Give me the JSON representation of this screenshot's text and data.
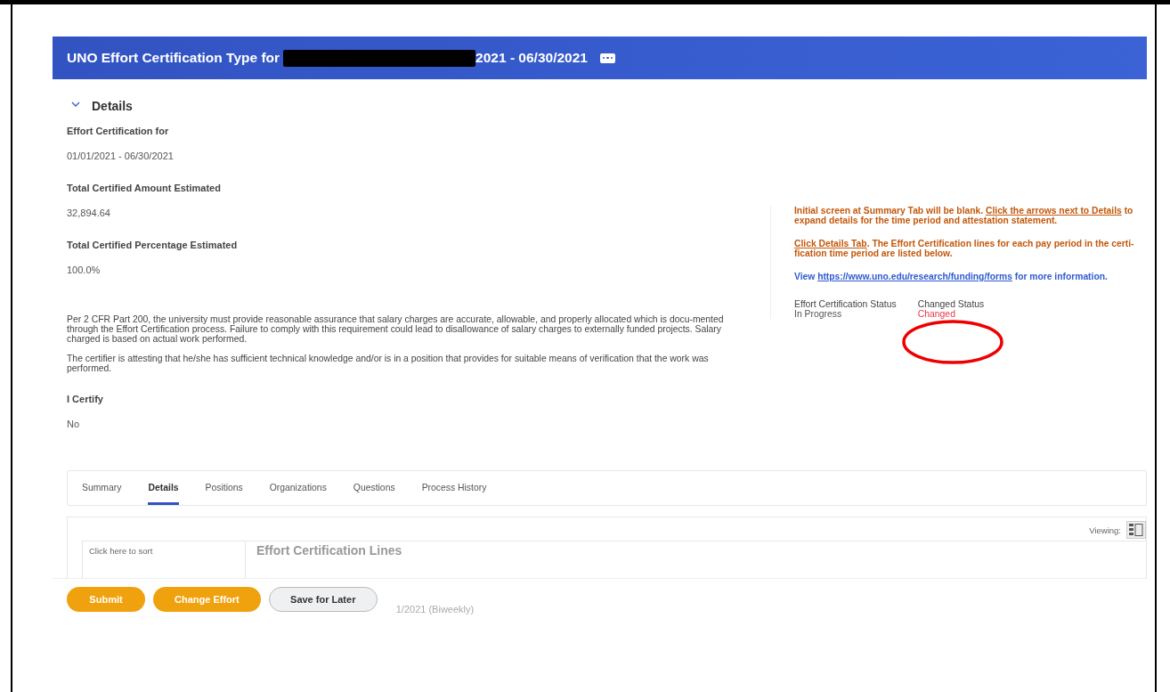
{
  "header": {
    "title_start": "UNO Effort Certification Type for",
    "title_end": "2021 - 06/30/2021",
    "redacted": true
  },
  "section": {
    "title": "Details",
    "expanded": true
  },
  "fields": [
    {
      "label": "Effort Certification for",
      "value": "01/01/2021 - 06/30/2021"
    },
    {
      "label": "Total Certified Amount Estimated",
      "value": "32,894.64"
    },
    {
      "label": "Total Certified Percentage Estimated",
      "value": "100.0%"
    }
  ],
  "statements": [
    "Per 2 CFR Part 200, the university must provide reasonable assurance that salary charges are accurate, allowable, and properly allocated which is docu-mented through the Effort Certification process. Failure to comply with this requirement could lead to disallowance of salary charges to externally funded projects. Salary charged is based on actual work performed.",
    "The certifier is attesting that he/she has sufficient technical knowledge and/or is in a position that provides for suitable means of verification that the work was performed."
  ],
  "certify": {
    "label": "I Certify",
    "value": "No"
  },
  "instructions": [
    {
      "kind": "orange",
      "parts": [
        {
          "text": "Initial screen at Summary Tab will be blank. ",
          "link": false
        },
        {
          "text": "Click the arrows next to Details",
          "link": true
        },
        {
          "text": " to expand details for the time period and attestation statement.",
          "link": false
        }
      ]
    },
    {
      "kind": "orange",
      "parts": [
        {
          "text": "Click Details Tab",
          "link": true
        },
        {
          "text": ". The Effort Certification lines for each pay period in the certi-fication time period are listed below.",
          "link": false
        }
      ]
    },
    {
      "kind": "blue",
      "parts": [
        {
          "text": "View ",
          "link": false
        },
        {
          "text": "https://www.uno.edu/research/funding/forms",
          "link": true
        },
        {
          "text": " for more information.",
          "link": false
        }
      ]
    }
  ],
  "status": [
    {
      "label": "Effort Certification Status",
      "value": "In Progress",
      "kind": "normal"
    },
    {
      "label": "Changed Status",
      "value": "Changed",
      "kind": "alert"
    }
  ],
  "tabs": [
    {
      "label": "Summary",
      "selected": false
    },
    {
      "label": "Details",
      "selected": true
    },
    {
      "label": "Positions",
      "selected": false
    },
    {
      "label": "Organizations",
      "selected": false
    },
    {
      "label": "Questions",
      "selected": false
    },
    {
      "label": "Process History",
      "selected": false
    }
  ],
  "viewing_label": "Viewing:",
  "sort_placeholder": "Click here to sort",
  "lines_title": "Effort Certification Lines",
  "period_text": "1/2021 (Biweekly)",
  "buttons": [
    {
      "label": "Submit",
      "kind": "primary"
    },
    {
      "label": "Change Effort",
      "kind": "primary"
    },
    {
      "label": "Save for Later",
      "kind": "secondary"
    }
  ]
}
